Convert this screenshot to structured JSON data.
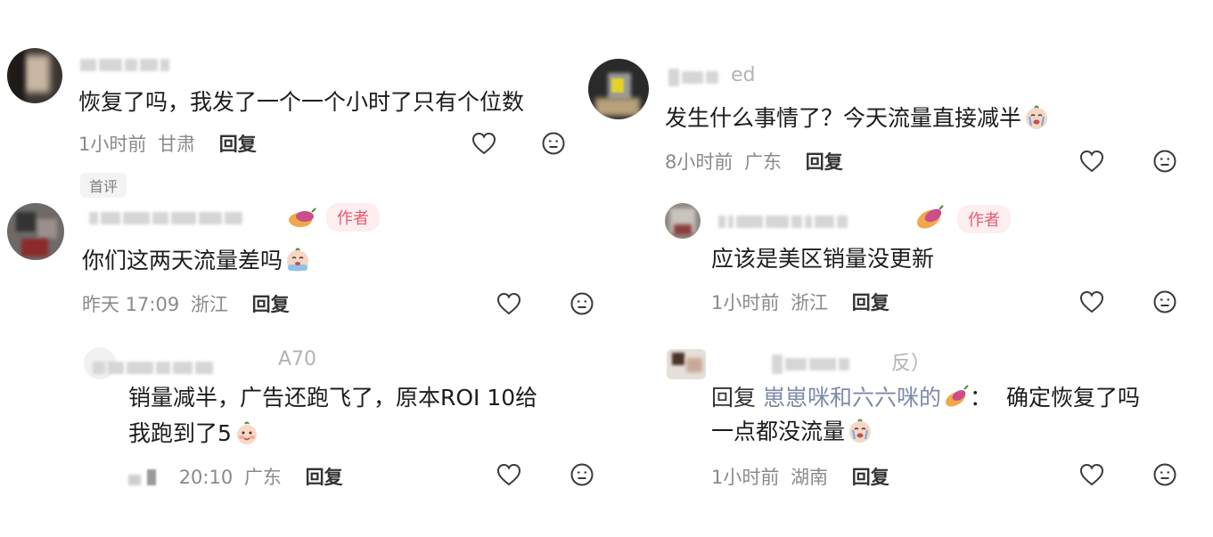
{
  "colors": {
    "text": "#1c1c1c",
    "meta": "#8a8a8a",
    "author": "#e85a6f",
    "author_bg": "#fdeef0",
    "link_name": "#7d8aa8"
  },
  "comments": [
    {
      "id": "c1",
      "text": "恢复了吗，我发了一个一个小时了只有个位数",
      "time": "1小时前",
      "region": "甘肃",
      "reply_label": "回复",
      "badge": "首评",
      "icons": [
        "heart-outline-icon",
        "dislike-face-icon"
      ]
    },
    {
      "id": "c2",
      "text": "你们这两天流量差吗",
      "emoji": "crying-face-icon",
      "author_badge": "作者",
      "time": "昨天 17:09",
      "region": "浙江",
      "reply_label": "回复",
      "icons": [
        "heart-outline-icon",
        "dislike-face-icon"
      ]
    },
    {
      "id": "c3",
      "name_suffix": "A70",
      "text_line1": "销量减半，广告还跑飞了，原本ROI 10给",
      "text_line2": "我跑到了5",
      "emoji": "smiling-face-icon",
      "time": "20:10",
      "region": "广东",
      "reply_label": "回复",
      "icons": [
        "heart-outline-icon",
        "dislike-face-icon"
      ]
    },
    {
      "id": "c4",
      "name_suffix": "ed",
      "text": "发生什么事情了？今天流量直接减半",
      "emoji": "crying-face-icon",
      "time": "8小时前",
      "region": "广东",
      "reply_label": "回复",
      "icons": [
        "heart-outline-icon",
        "dislike-face-icon"
      ]
    },
    {
      "id": "c5",
      "text": "应该是美区销量没更新",
      "author_badge": "作者",
      "time": "1小时前",
      "region": "浙江",
      "reply_label": "回复",
      "icons": [
        "heart-outline-icon",
        "dislike-face-icon"
      ]
    },
    {
      "id": "c6",
      "name_suffix": "反）",
      "reply_prefix": "回复",
      "reply_name": "崽崽咪和六六咪的",
      "reply_colon": "：",
      "text_line1": "确定恢复了吗",
      "text_line2": "一点都没流量",
      "emoji": "crying-face-icon",
      "time": "1小时前",
      "region": "湖南",
      "reply_label": "回复",
      "icons": [
        "heart-outline-icon",
        "dislike-face-icon"
      ]
    }
  ]
}
